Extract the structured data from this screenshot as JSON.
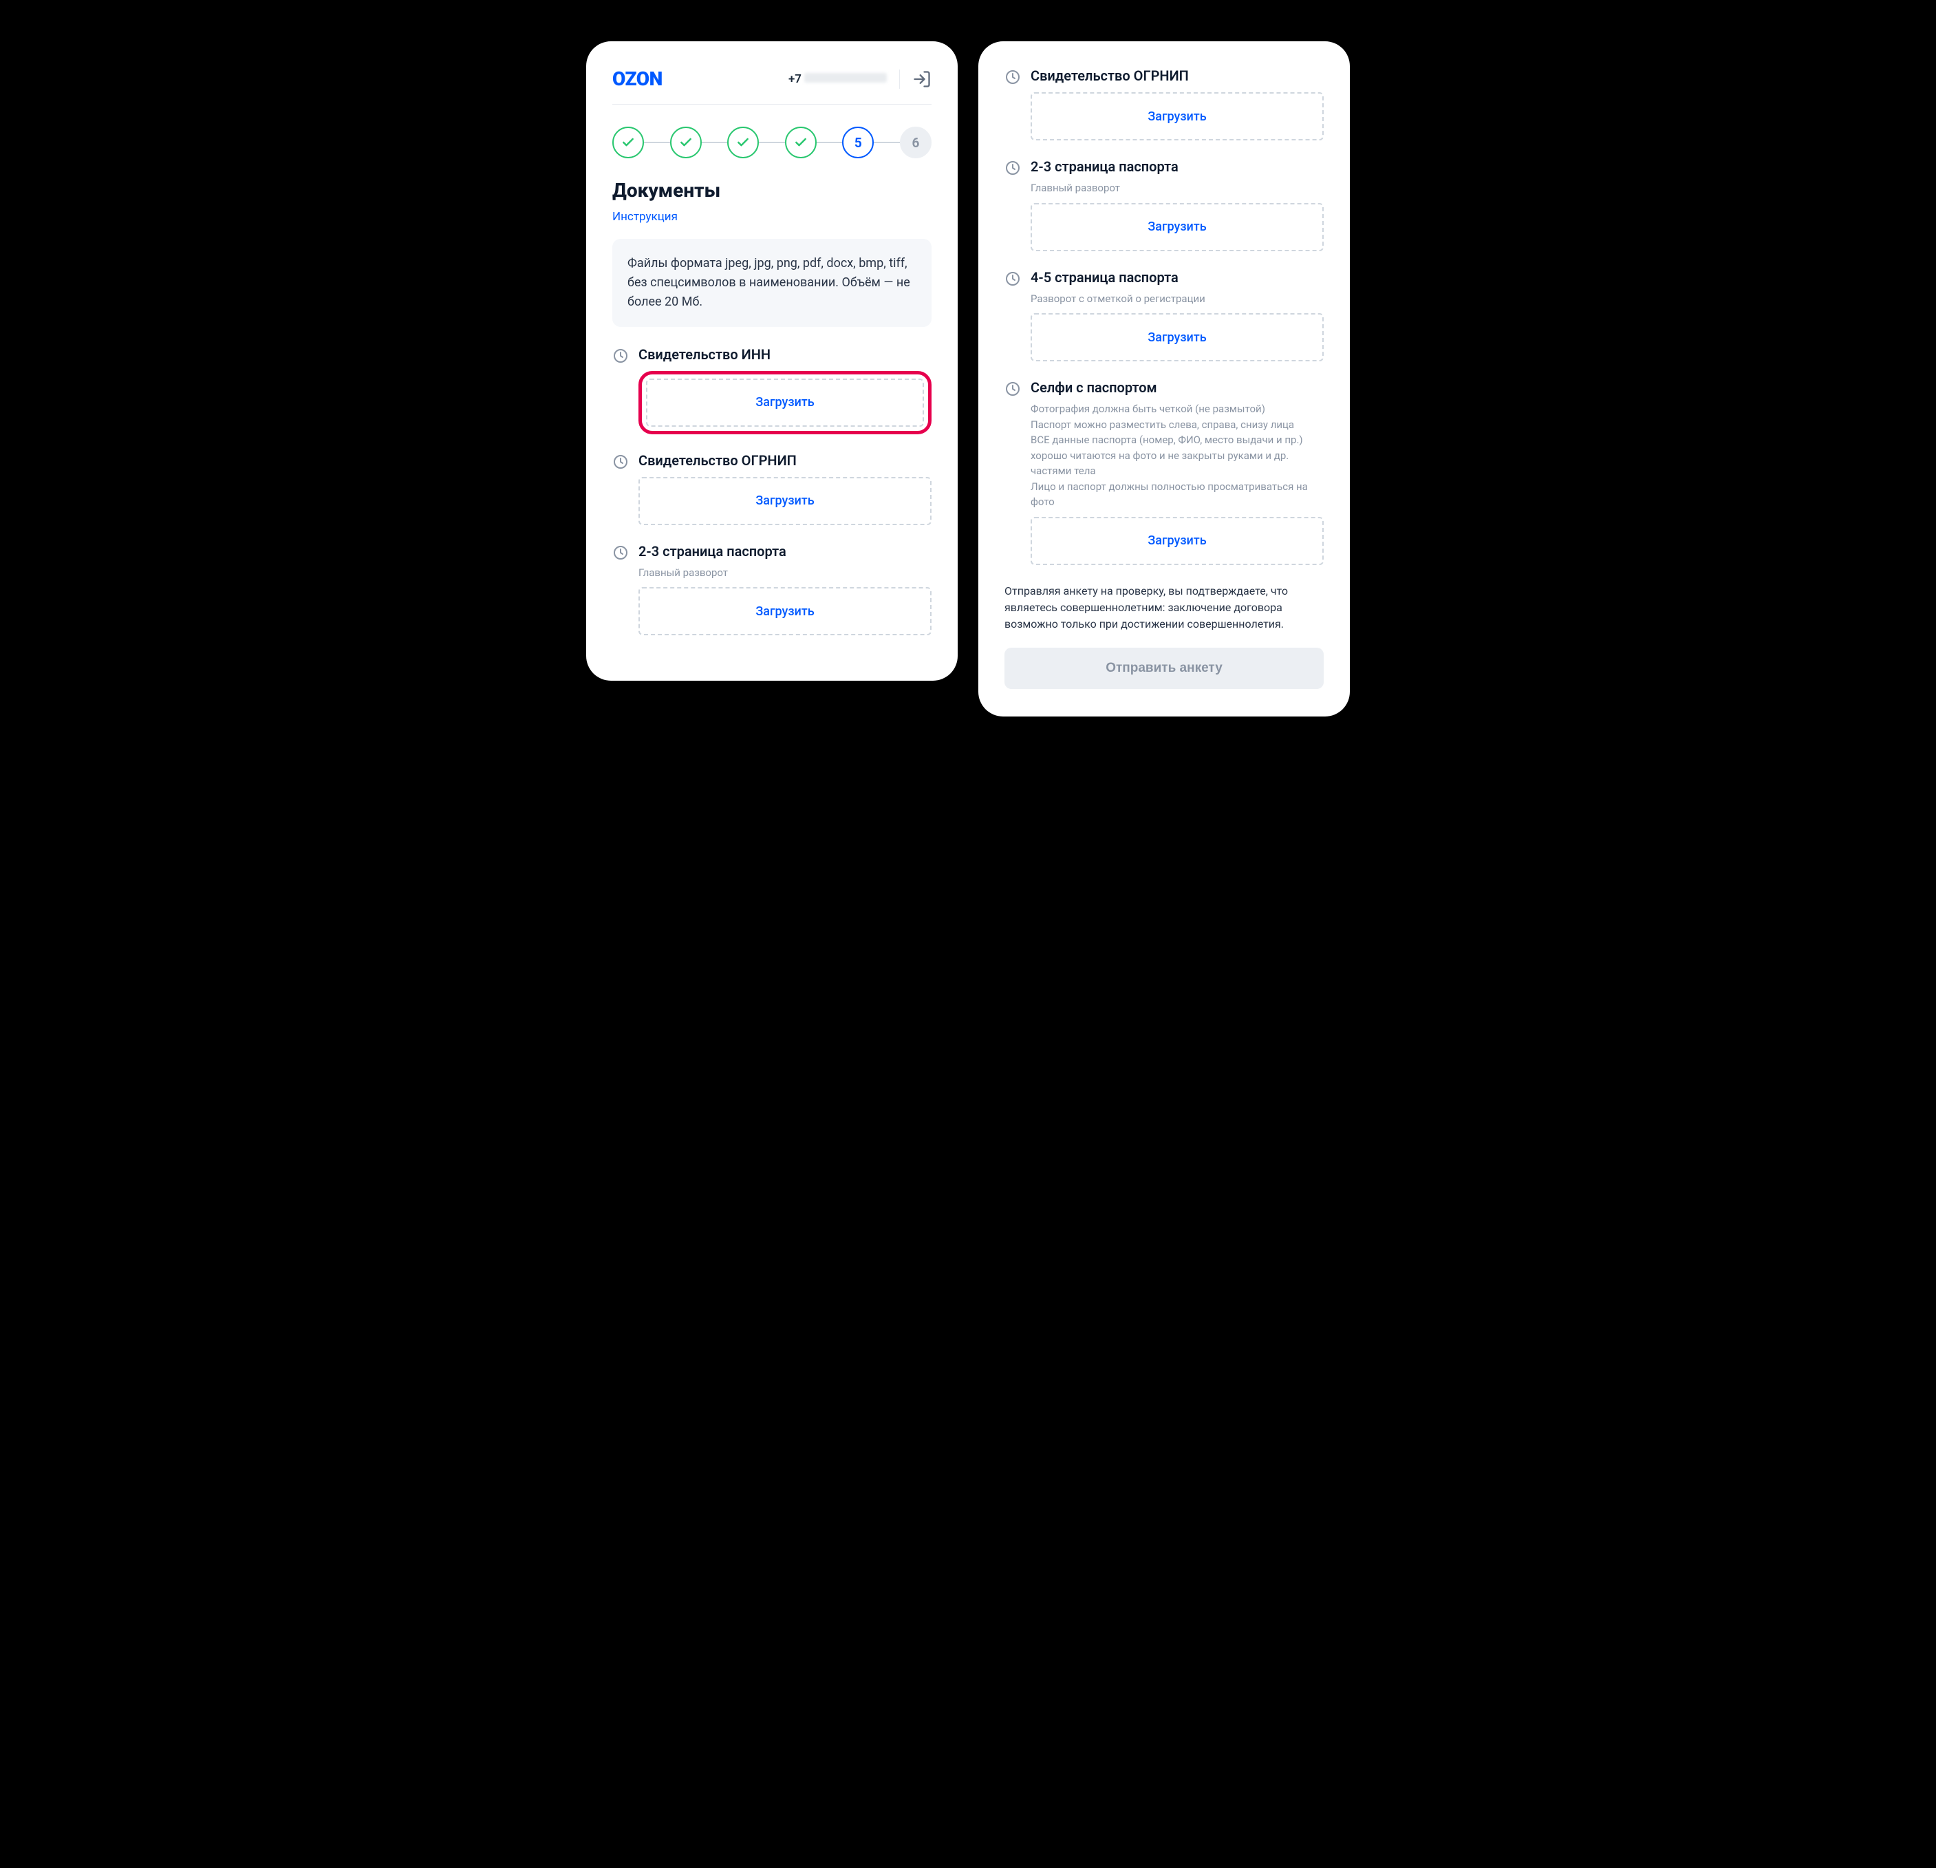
{
  "header": {
    "logo_text": "OZON",
    "phone_prefix": "+7"
  },
  "stepper": {
    "steps": [
      {
        "state": "done"
      },
      {
        "state": "done"
      },
      {
        "state": "done"
      },
      {
        "state": "done"
      },
      {
        "state": "current",
        "label": "5"
      },
      {
        "state": "future",
        "label": "6"
      }
    ]
  },
  "page": {
    "title": "Документы",
    "instruction_link": "Инструкция",
    "info_text": "Файлы формата jpeg, jpg, png, pdf, docx, bmp, tiff, без спецсимволов в наименовании. Объём — не более 20 Мб."
  },
  "uploads_left": [
    {
      "title": "Свидетельство ИНН",
      "btn": "Загрузить",
      "highlight": true
    },
    {
      "title": "Свидетельство ОГРНИП",
      "btn": "Загрузить"
    },
    {
      "title": "2-3 страница паспорта",
      "sub": "Главный разворот",
      "btn": "Загрузить"
    }
  ],
  "uploads_right": [
    {
      "title": "Свидетельство ОГРНИП",
      "btn": "Загрузить"
    },
    {
      "title": "2-3 страница паспорта",
      "sub": "Главный разворот",
      "btn": "Загрузить"
    },
    {
      "title": "4-5 страница паспорта",
      "sub": "Разворот с отметкой о регистрации",
      "btn": "Загрузить"
    },
    {
      "title": "Селфи с паспортом",
      "sub": "Фотография должна быть четкой (не размытой)\nПаспорт можно разместить слева, справа, снизу лица\nВСЕ данные паспорта (номер, ФИО, место выдачи и пр.) хорошо читаются на фото и не закрыты руками и др. частями тела\nЛицо и паспорт должны полностью просматриваться на фото",
      "btn": "Загрузить"
    }
  ],
  "disclaimer": "Отправляя анкету на проверку, вы подтверждаете, что являетесь совершеннолетним: заключение договора возможно только при достижении совершеннолетия.",
  "submit_label": "Отправить анкету"
}
